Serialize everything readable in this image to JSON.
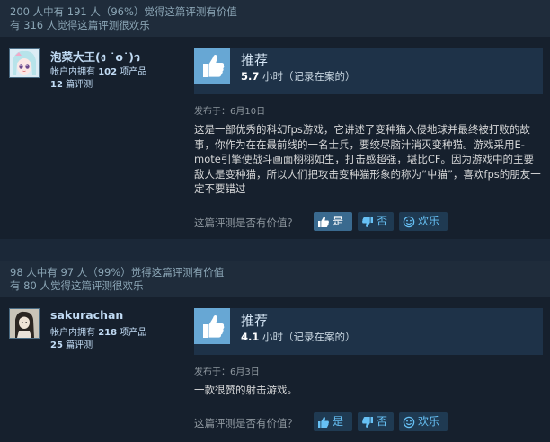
{
  "reviews": [
    {
      "helpful_line": "200 人中有 191 人（96%）觉得这篇评测有价值",
      "funny_line": "有 316 人觉得这篇评测很欢乐",
      "author": {
        "name": "泡菜大王(ง ˙o˙)ว",
        "products_prefix": "帐户内拥有 ",
        "products_count": "102",
        "products_suffix": " 项产品",
        "reviews_count": "12",
        "reviews_suffix": " 篇评测"
      },
      "verdict": "推荐",
      "hours_value": "5.7",
      "hours_suffix": " 小时（记录在案的）",
      "posted": "发布于：6月10日",
      "text": "这是一部优秀的科幻fps游戏，它讲述了变种猫入侵地球并最终被打败的故事，你作为在在最前线的一名士兵，要绞尽脑汁消灭变种猫。游戏采用E-mote引擎使战斗画面栩栩如生，打击感超强，堪比CF。因为游戏中的主要敌人是变种猫，所以人们把攻击变种猫形象的称为“屮猫”，喜欢fps的朋友一定不要错过",
      "vote_question": "这篇评测是否有价值？",
      "yes_label": "是",
      "no_label": "否",
      "funny_label": "欢乐",
      "yes_selected": true
    },
    {
      "helpful_line": "98 人中有 97 人（99%）觉得这篇评测有价值",
      "funny_line": "有 80 人觉得这篇评测很欢乐",
      "author": {
        "name": "sakurachan",
        "products_prefix": "帐户内拥有 ",
        "products_count": "218",
        "products_suffix": " 项产品",
        "reviews_count": "25",
        "reviews_suffix": " 篇评测"
      },
      "verdict": "推荐",
      "hours_value": "4.1",
      "hours_suffix": " 小时（记录在案的）",
      "posted": "发布于：6月3日",
      "text": "一款很赞的射击游戏。",
      "vote_question": "这篇评测是否有价值？",
      "yes_label": "是",
      "no_label": "否",
      "funny_label": "欢乐",
      "yes_selected": false
    }
  ],
  "icons": {
    "thumbs_up": "thumbs-up-icon",
    "thumbs_down": "thumbs-down-icon",
    "smiley": "smiley-icon"
  },
  "colors": {
    "background": "#1b2838",
    "link_blue": "#67c1f5",
    "thumb_box": "#67a7d4"
  }
}
